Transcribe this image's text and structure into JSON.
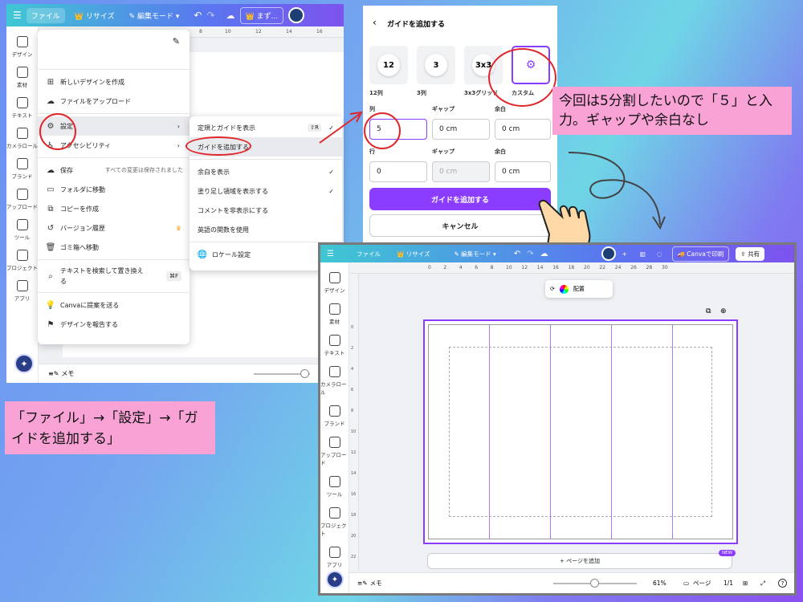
{
  "left": {
    "topbar": {
      "file": "ファイル",
      "resize": "リサイズ",
      "edit_mode": "編集モード",
      "more": "まず..."
    },
    "ruler": [
      "8",
      "10",
      "12",
      "14",
      "16"
    ],
    "sidebar": [
      {
        "label": "デザイン",
        "icon": "design-icon"
      },
      {
        "label": "素材",
        "icon": "elements-icon"
      },
      {
        "label": "テキスト",
        "icon": "text-icon"
      },
      {
        "label": "カメラロール",
        "icon": "camera-icon"
      },
      {
        "label": "ブランド",
        "icon": "brand-icon"
      },
      {
        "label": "アップロード",
        "icon": "upload-icon"
      },
      {
        "label": "ツール",
        "icon": "tool-icon"
      },
      {
        "label": "プロジェクト",
        "icon": "folder-icon"
      },
      {
        "label": "アプリ",
        "icon": "apps-icon"
      }
    ],
    "file_menu": {
      "items1": [
        "新しいデザインを作成",
        "ファイルをアップロード"
      ],
      "settings": "設定",
      "accessibility": "アクセシビリティ",
      "save": "保存",
      "save_status": "すべての変更は保存されました",
      "items2": [
        "フォルダに移動",
        "コピーを作成",
        "バージョン履歴",
        "ゴミ箱へ移動"
      ],
      "find_replace": "テキストを検索して置き換える",
      "find_shortcut": "⌘F",
      "items3": [
        "Canvaに提案を送る",
        "デザインを報告する"
      ]
    },
    "submenu": {
      "show_rulers": "定規とガイドを表示",
      "show_rulers_shortcut": "⇧R",
      "add_guides": "ガイドを追加する",
      "show_margins": "余白を表示",
      "show_bleed": "塗り足し領域を表示する",
      "hide_comments": "コメントを非表示にする",
      "english_functions": "英語の関数を使用",
      "locale": "ロケール設定"
    },
    "bottom": {
      "notes": "メモ"
    }
  },
  "guide_dialog": {
    "title": "ガイドを追加する",
    "presets": [
      {
        "tile": "12",
        "label": "12列"
      },
      {
        "tile": "3",
        "label": "3列"
      },
      {
        "tile": "3x3",
        "label": "3x3グリッド"
      },
      {
        "tile": "",
        "label": "カスタム"
      }
    ],
    "col_label": "列",
    "gap_label": "ギャップ",
    "margin_label": "余白",
    "row_label": "行",
    "col_value": "5",
    "col_gap": "0 cm",
    "col_margin": "0 cm",
    "row_value": "0",
    "row_gap_placeholder": "0 cm",
    "row_margin": "0 cm",
    "add_button": "ガイドを追加する",
    "cancel_button": "キャンセル"
  },
  "notes": {
    "right": "今回は5分割したいので「５」と入力。ギャップや余白なし",
    "left": "「ファイル」→「設定」→「ガイドを追加する」"
  },
  "right": {
    "topbar": {
      "file": "ファイル",
      "resize": "リサイズ",
      "edit_mode": "編集モード",
      "print": "Canvaで印刷",
      "share": "共有"
    },
    "ruler": [
      "0",
      "2",
      "4",
      "6",
      "8",
      "10",
      "12",
      "14",
      "16",
      "18",
      "20",
      "22",
      "24",
      "26",
      "28",
      "30"
    ],
    "vruler": [
      "0",
      "2",
      "4",
      "6",
      "8",
      "10",
      "12",
      "14",
      "16",
      "18",
      "20",
      "22"
    ],
    "sidebar": [
      {
        "label": "デザイン",
        "icon": "design-icon"
      },
      {
        "label": "素材",
        "icon": "elements-icon"
      },
      {
        "label": "テキスト",
        "icon": "text-icon"
      },
      {
        "label": "カメラロール",
        "icon": "camera-icon"
      },
      {
        "label": "ブランド",
        "icon": "brand-icon"
      },
      {
        "label": "アップロード",
        "icon": "upload-icon"
      },
      {
        "label": "ツール",
        "icon": "tool-icon"
      },
      {
        "label": "プロジェクト",
        "icon": "folder-icon"
      },
      {
        "label": "アプリ",
        "icon": "apps-icon"
      }
    ],
    "float_toolbar": {
      "arrange": "配置"
    },
    "add_page": "+ ページを追加",
    "new_badge": "NEW",
    "bottom": {
      "notes": "メモ",
      "zoom": "61%",
      "pages": "ページ",
      "page_count": "1/1"
    }
  }
}
